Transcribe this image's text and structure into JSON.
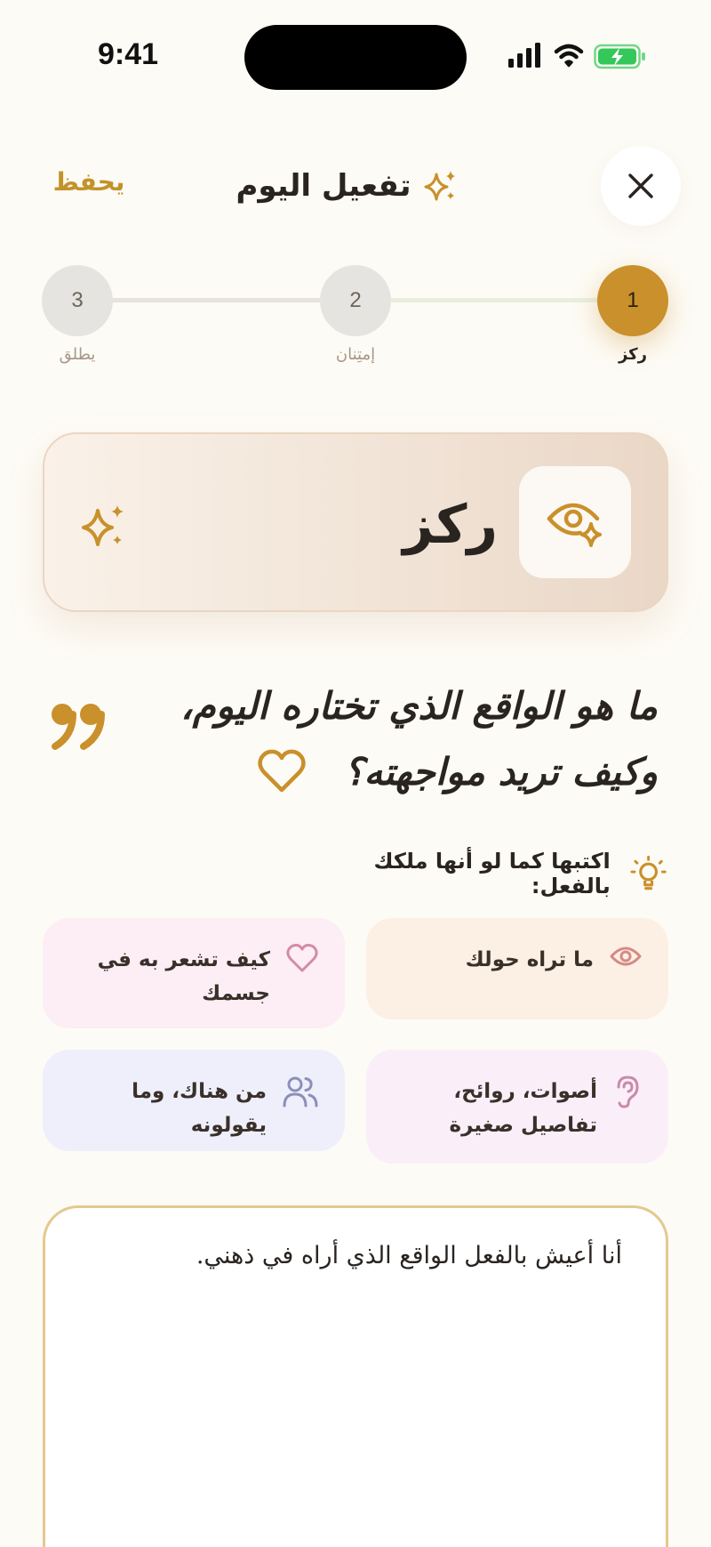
{
  "status_bar": {
    "time": "9:41",
    "icons": [
      "signal-icon",
      "wifi-icon",
      "battery-charging-icon"
    ],
    "battery_color": "#34C759"
  },
  "header": {
    "title": "تفعيل اليوم",
    "save_label": "يحفظ",
    "icons": [
      "close-icon",
      "sparkle-icon"
    ]
  },
  "stepper": {
    "current": 1,
    "steps": [
      {
        "number": "1",
        "label": "ركز"
      },
      {
        "number": "2",
        "label": "إمتِنان"
      },
      {
        "number": "3",
        "label": "يطلق"
      }
    ]
  },
  "focus_card": {
    "title": "ركز",
    "icons": [
      "eye-sparkle-icon",
      "sparkle-icon"
    ]
  },
  "question": {
    "text": "ما هو الواقع الذي تختاره اليوم، وكيف تريد مواجهته؟",
    "icons": [
      "quote-icon",
      "heart-icon"
    ]
  },
  "hint": {
    "text": "اكتبها كما لو أنها ملكك بالفعل:",
    "icon": "lightbulb-icon"
  },
  "prompts": [
    {
      "label": "ما تراه حولك",
      "icon": "eye-icon"
    },
    {
      "label": "كيف تشعر به في جسمك",
      "icon": "heart-icon"
    },
    {
      "label": "أصوات، روائح، تفاصيل صغيرة",
      "icon": "ear-icon"
    },
    {
      "label": "من هناك، وما يقولونه",
      "icon": "people-icon"
    }
  ],
  "entry": {
    "value": "أنا أعيش بالفعل الواقع الذي أراه في ذهني."
  },
  "colors": {
    "background": "#FDFBF5",
    "accent": "#C9902B",
    "text": "#2A2420"
  }
}
